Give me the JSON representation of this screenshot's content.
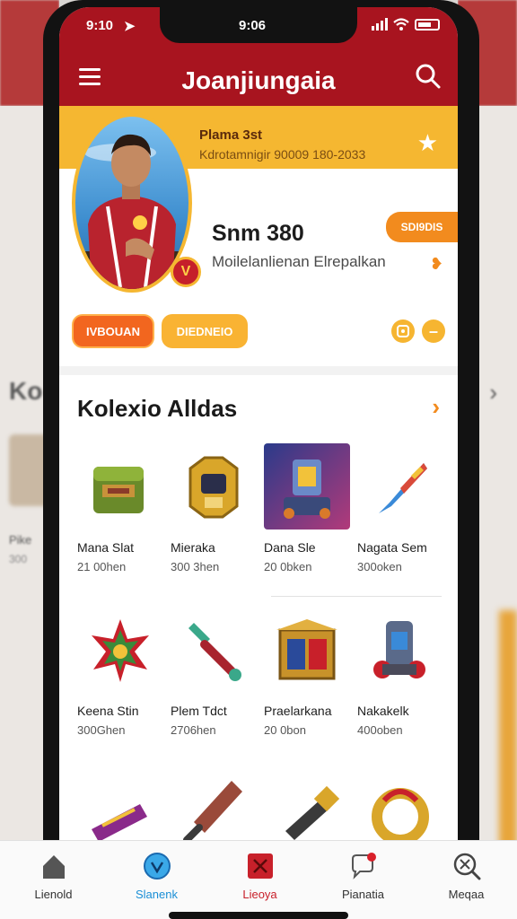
{
  "status_bar": {
    "time": "9:10",
    "center_time": "9:06",
    "nav_arrow": "➤"
  },
  "header": {
    "title": "Joanjiungaia"
  },
  "profile": {
    "name": "Plama 3st",
    "subtitle": "Kdrotamnigir 90009 180-2033",
    "count": "Snm 380",
    "description": "Moilelanlienan Elrepalkan",
    "chip_label": "SDI9DIS",
    "button_primary": "IVBOUAN",
    "button_secondary": "DIEDNEIO",
    "badge_glyph": "V"
  },
  "collection": {
    "title": "Kolexio Alldas",
    "items": [
      {
        "name": "Mana Slat",
        "price": "21 00hen",
        "icon": "chest-icon"
      },
      {
        "name": "Mieraka",
        "price": "300 3hen",
        "icon": "robot-mask-icon"
      },
      {
        "name": "Dana Sle",
        "price": "20 0bken",
        "icon": "robot-icon"
      },
      {
        "name": "Nagata Sem",
        "price": "300oken",
        "icon": "crystal-icon"
      },
      {
        "name": "Keena Stin",
        "price": "300Ghen",
        "icon": "flower-icon"
      },
      {
        "name": "Plem Tdct",
        "price": "2706hen",
        "icon": "hammer-icon"
      },
      {
        "name": "Praelarkana",
        "price": "20 0bon",
        "icon": "crate-icon"
      },
      {
        "name": "Nakakelk",
        "price": "400oben",
        "icon": "cannon-icon"
      }
    ]
  },
  "bottom_nav": [
    {
      "label": "Lienold",
      "icon": "home-icon",
      "color": "#333333"
    },
    {
      "label": "Slanenk",
      "icon": "check-circle-icon",
      "color": "#1a8fd6"
    },
    {
      "label": "Lieoya",
      "icon": "flag-x-icon",
      "color": "#c8202a"
    },
    {
      "label": "Pianatia",
      "icon": "chat-icon",
      "color": "#555555"
    },
    {
      "label": "Meqaa",
      "icon": "search-x-icon",
      "color": "#555555"
    }
  ],
  "background": {
    "left_heading": "Ko",
    "left_label": "Pike",
    "left_price": "300"
  }
}
